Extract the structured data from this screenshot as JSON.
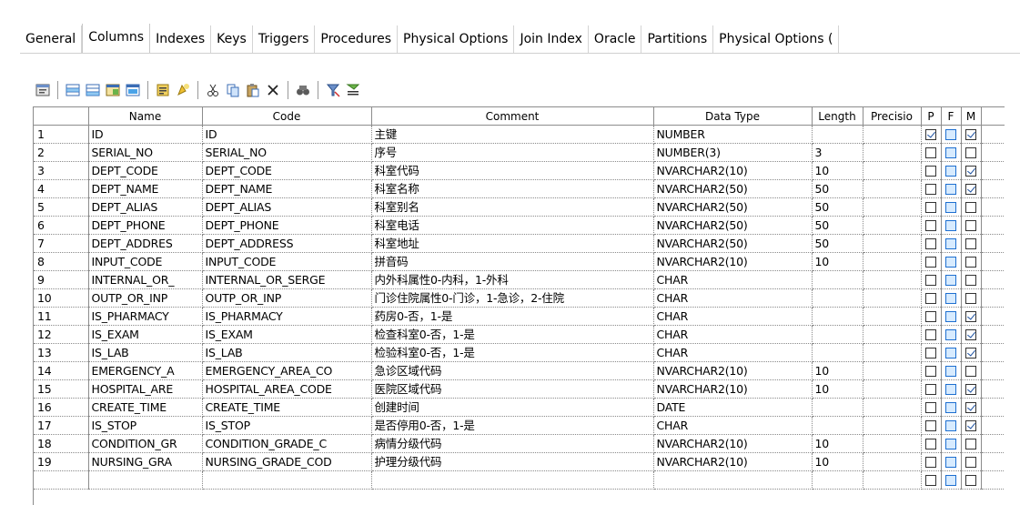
{
  "tabs": [
    {
      "label": "General",
      "active": false
    },
    {
      "label": "Columns",
      "active": true
    },
    {
      "label": "Indexes",
      "active": false
    },
    {
      "label": "Keys",
      "active": false
    },
    {
      "label": "Triggers",
      "active": false
    },
    {
      "label": "Procedures",
      "active": false
    },
    {
      "label": "Physical Options",
      "active": false
    },
    {
      "label": "Join Index",
      "active": false
    },
    {
      "label": "Oracle",
      "active": false
    },
    {
      "label": "Partitions",
      "active": false
    },
    {
      "label": "Physical Options (",
      "active": false
    }
  ],
  "toolbar": {
    "icons": [
      "properties-icon",
      "insert-row-icon",
      "add-row-icon",
      "add-columns-icon",
      "delete-row-icon",
      "domain-icon",
      "new-domain-icon",
      "cut-icon",
      "copy-icon",
      "paste-icon",
      "delete-icon",
      "find-icon",
      "filter-icon",
      "customize-columns-icon"
    ]
  },
  "grid": {
    "columns": [
      "Name",
      "Code",
      "Comment",
      "Data Type",
      "Length",
      "Precisio",
      "P",
      "F",
      "M"
    ],
    "rows": [
      {
        "num": "1",
        "name": "ID",
        "code": "ID",
        "comment": "主键",
        "type": "NUMBER",
        "length": "",
        "p": true,
        "f": false,
        "m": true
      },
      {
        "num": "2",
        "name": "SERIAL_NO",
        "code": "SERIAL_NO",
        "comment": "序号",
        "type": "NUMBER(3)",
        "length": "3",
        "p": false,
        "f": false,
        "m": false
      },
      {
        "num": "3",
        "name": "DEPT_CODE",
        "code": "DEPT_CODE",
        "comment": "科室代码",
        "type": "NVARCHAR2(10)",
        "length": "10",
        "p": false,
        "f": false,
        "m": true
      },
      {
        "num": "4",
        "name": "DEPT_NAME",
        "code": "DEPT_NAME",
        "comment": "科室名称",
        "type": "NVARCHAR2(50)",
        "length": "50",
        "p": false,
        "f": false,
        "m": true
      },
      {
        "num": "5",
        "name": "DEPT_ALIAS",
        "code": "DEPT_ALIAS",
        "comment": "科室别名",
        "type": "NVARCHAR2(50)",
        "length": "50",
        "p": false,
        "f": false,
        "m": false
      },
      {
        "num": "6",
        "name": "DEPT_PHONE",
        "code": "DEPT_PHONE",
        "comment": "科室电话",
        "type": "NVARCHAR2(50)",
        "length": "50",
        "p": false,
        "f": false,
        "m": false
      },
      {
        "num": "7",
        "name": "DEPT_ADDRES",
        "code": "DEPT_ADDRESS",
        "comment": "科室地址",
        "type": "NVARCHAR2(50)",
        "length": "50",
        "p": false,
        "f": false,
        "m": false
      },
      {
        "num": "8",
        "name": "INPUT_CODE",
        "code": "INPUT_CODE",
        "comment": "拼音码",
        "type": "NVARCHAR2(10)",
        "length": "10",
        "p": false,
        "f": false,
        "m": false
      },
      {
        "num": "9",
        "name": "INTERNAL_OR_",
        "code": "INTERNAL_OR_SERGE",
        "comment": "内外科属性0-内科，1-外科",
        "type": "CHAR",
        "length": "",
        "p": false,
        "f": false,
        "m": false
      },
      {
        "num": "10",
        "name": "OUTP_OR_INP",
        "code": "OUTP_OR_INP",
        "comment": "门诊住院属性0-门诊，1-急诊，2-住院",
        "type": "CHAR",
        "length": "",
        "p": false,
        "f": false,
        "m": false
      },
      {
        "num": "11",
        "name": "IS_PHARMACY",
        "code": "IS_PHARMACY",
        "comment": "药房0-否，1-是",
        "type": "CHAR",
        "length": "",
        "p": false,
        "f": false,
        "m": true
      },
      {
        "num": "12",
        "name": "IS_EXAM",
        "code": "IS_EXAM",
        "comment": "检查科室0-否，1-是",
        "type": "CHAR",
        "length": "",
        "p": false,
        "f": false,
        "m": true
      },
      {
        "num": "13",
        "name": "IS_LAB",
        "code": "IS_LAB",
        "comment": "检验科室0-否，1-是",
        "type": "CHAR",
        "length": "",
        "p": false,
        "f": false,
        "m": true
      },
      {
        "num": "14",
        "name": "EMERGENCY_A",
        "code": "EMERGENCY_AREA_CO",
        "comment": "急诊区域代码",
        "type": "NVARCHAR2(10)",
        "length": "10",
        "p": false,
        "f": false,
        "m": false
      },
      {
        "num": "15",
        "name": "HOSPITAL_ARE",
        "code": "HOSPITAL_AREA_CODE",
        "comment": "医院区域代码",
        "type": "NVARCHAR2(10)",
        "length": "10",
        "p": false,
        "f": false,
        "m": true
      },
      {
        "num": "16",
        "name": "CREATE_TIME",
        "code": "CREATE_TIME",
        "comment": "创建时间",
        "type": "DATE",
        "length": "",
        "p": false,
        "f": false,
        "m": true
      },
      {
        "num": "17",
        "name": "IS_STOP",
        "code": "IS_STOP",
        "comment": "是否停用0-否，1-是",
        "type": "CHAR",
        "length": "",
        "p": false,
        "f": false,
        "m": true
      },
      {
        "num": "18",
        "name": "CONDITION_GR",
        "code": "CONDITION_GRADE_C",
        "comment": "病情分级代码",
        "type": "NVARCHAR2(10)",
        "length": "10",
        "p": false,
        "f": false,
        "m": false
      },
      {
        "num": "19",
        "name": "NURSING_GRA",
        "code": "NURSING_GRADE_COD",
        "comment": "护理分级代码",
        "type": "NVARCHAR2(10)",
        "length": "10",
        "p": false,
        "f": false,
        "m": false
      }
    ]
  }
}
